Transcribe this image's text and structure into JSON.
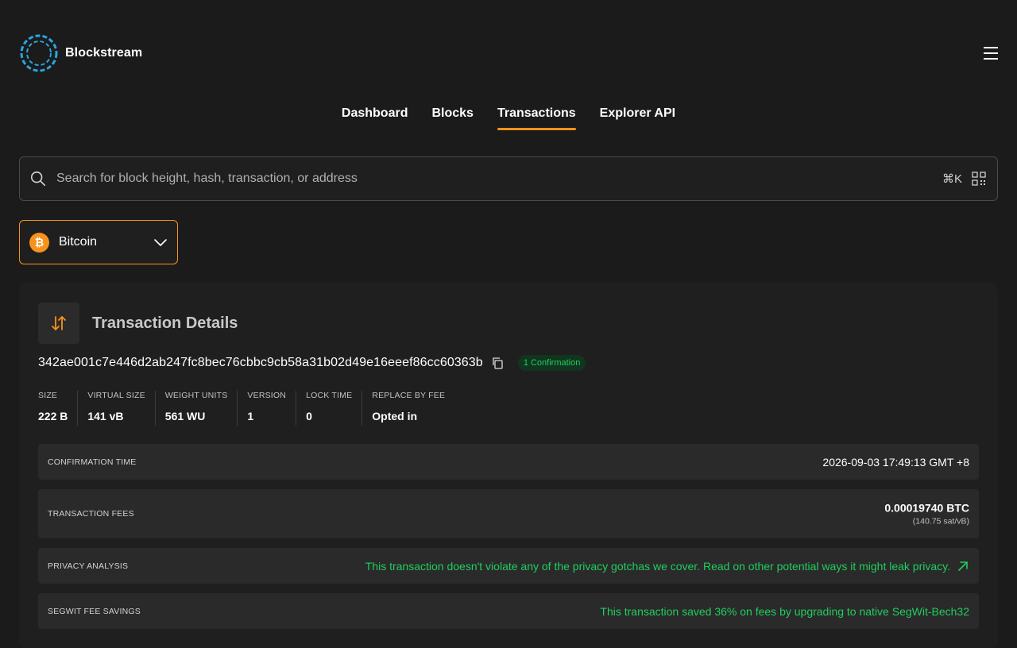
{
  "brand": {
    "name": "Blockstream"
  },
  "nav": {
    "items": [
      {
        "label": "Dashboard"
      },
      {
        "label": "Blocks"
      },
      {
        "label": "Transactions"
      },
      {
        "label": "Explorer API"
      }
    ],
    "active": "Transactions"
  },
  "search": {
    "placeholder": "Search for block height, hash, transaction, or address",
    "value": "",
    "shortcut": "⌘K",
    "icons": [
      "search-icon",
      "qr-code-icon"
    ]
  },
  "network": {
    "label": "Bitcoin",
    "icon": "bitcoin-icon"
  },
  "transaction": {
    "title": "Transaction Details",
    "hash": "342ae001c7e446d2ab247fc8bec76cbbc9cb58a31b02d49e16eeef86cc60363b",
    "confirmations": "1 Confirmation",
    "stats": [
      {
        "label": "SIZE",
        "value": "222 B"
      },
      {
        "label": "VIRTUAL SIZE",
        "value": "141 vB"
      },
      {
        "label": "WEIGHT UNITS",
        "value": "561 WU"
      },
      {
        "label": "VERSION",
        "value": "1"
      },
      {
        "label": "LOCK TIME",
        "value": "0"
      },
      {
        "label": "REPLACE BY FEE",
        "value": "Opted in"
      }
    ],
    "rows": {
      "confirmation_time": {
        "label": "CONFIRMATION TIME",
        "value": "2026-09-03 17:49:13 GMT +8"
      },
      "fees": {
        "label": "TRANSACTION FEES",
        "value": "0.00019740 BTC",
        "rate": "(140.75 sat/vB)"
      },
      "privacy": {
        "label": "PRIVACY ANALYSIS",
        "value": "This transaction doesn't violate any of the privacy gotchas we cover. Read on other potential ways it might leak privacy."
      },
      "segwit": {
        "label": "SEGWIT FEE SAVINGS",
        "value": "This transaction saved 36% on fees by upgrading to native SegWit-Bech32"
      }
    }
  },
  "colors": {
    "accent": "#f7931a",
    "success": "#1fce5e",
    "background": "#1b1b1b"
  }
}
